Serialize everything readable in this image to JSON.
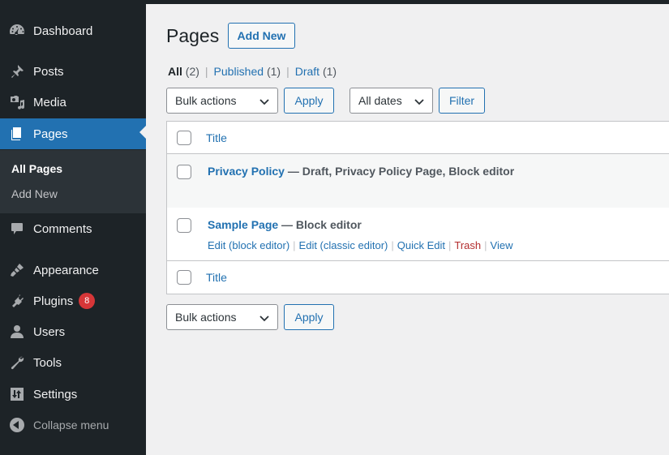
{
  "sidebar": {
    "items": [
      {
        "label": "Dashboard",
        "icon": "dashboard-icon"
      },
      {
        "label": "Posts",
        "icon": "pin-icon"
      },
      {
        "label": "Media",
        "icon": "media-icon"
      },
      {
        "label": "Pages",
        "icon": "pages-icon",
        "active": true
      },
      {
        "label": "Comments",
        "icon": "comment-icon"
      },
      {
        "label": "Appearance",
        "icon": "brush-icon"
      },
      {
        "label": "Plugins",
        "icon": "plugin-icon",
        "badge": "8"
      },
      {
        "label": "Users",
        "icon": "user-icon"
      },
      {
        "label": "Tools",
        "icon": "wrench-icon"
      },
      {
        "label": "Settings",
        "icon": "settings-icon"
      }
    ],
    "submenu": [
      {
        "label": "All Pages",
        "current": true
      },
      {
        "label": "Add New"
      }
    ],
    "collapse_label": "Collapse menu"
  },
  "header": {
    "title": "Pages",
    "add_new_label": "Add New"
  },
  "views": [
    {
      "label": "All",
      "count": "(2)",
      "current": true
    },
    {
      "label": "Published",
      "count": "(1)"
    },
    {
      "label": "Draft",
      "count": "(1)"
    }
  ],
  "toolbar_top": {
    "bulk_actions": "Bulk actions",
    "apply_label": "Apply",
    "dates": "All dates",
    "filter_label": "Filter"
  },
  "table": {
    "column_title": "Title",
    "rows": [
      {
        "title": "Privacy Policy",
        "states": " — Draft, Privacy Policy Page, Block editor"
      },
      {
        "title": "Sample Page",
        "states": " — Block editor",
        "actions": [
          "Edit (block editor)",
          "Edit (classic editor)",
          "Quick Edit",
          "Trash",
          "View"
        ]
      }
    ]
  },
  "toolbar_bottom": {
    "bulk_actions": "Bulk actions",
    "apply_label": "Apply"
  },
  "colors": {
    "sidebar_bg": "#1d2327",
    "accent": "#2271b1",
    "badge": "#d63638",
    "trash": "#b32d2e"
  }
}
